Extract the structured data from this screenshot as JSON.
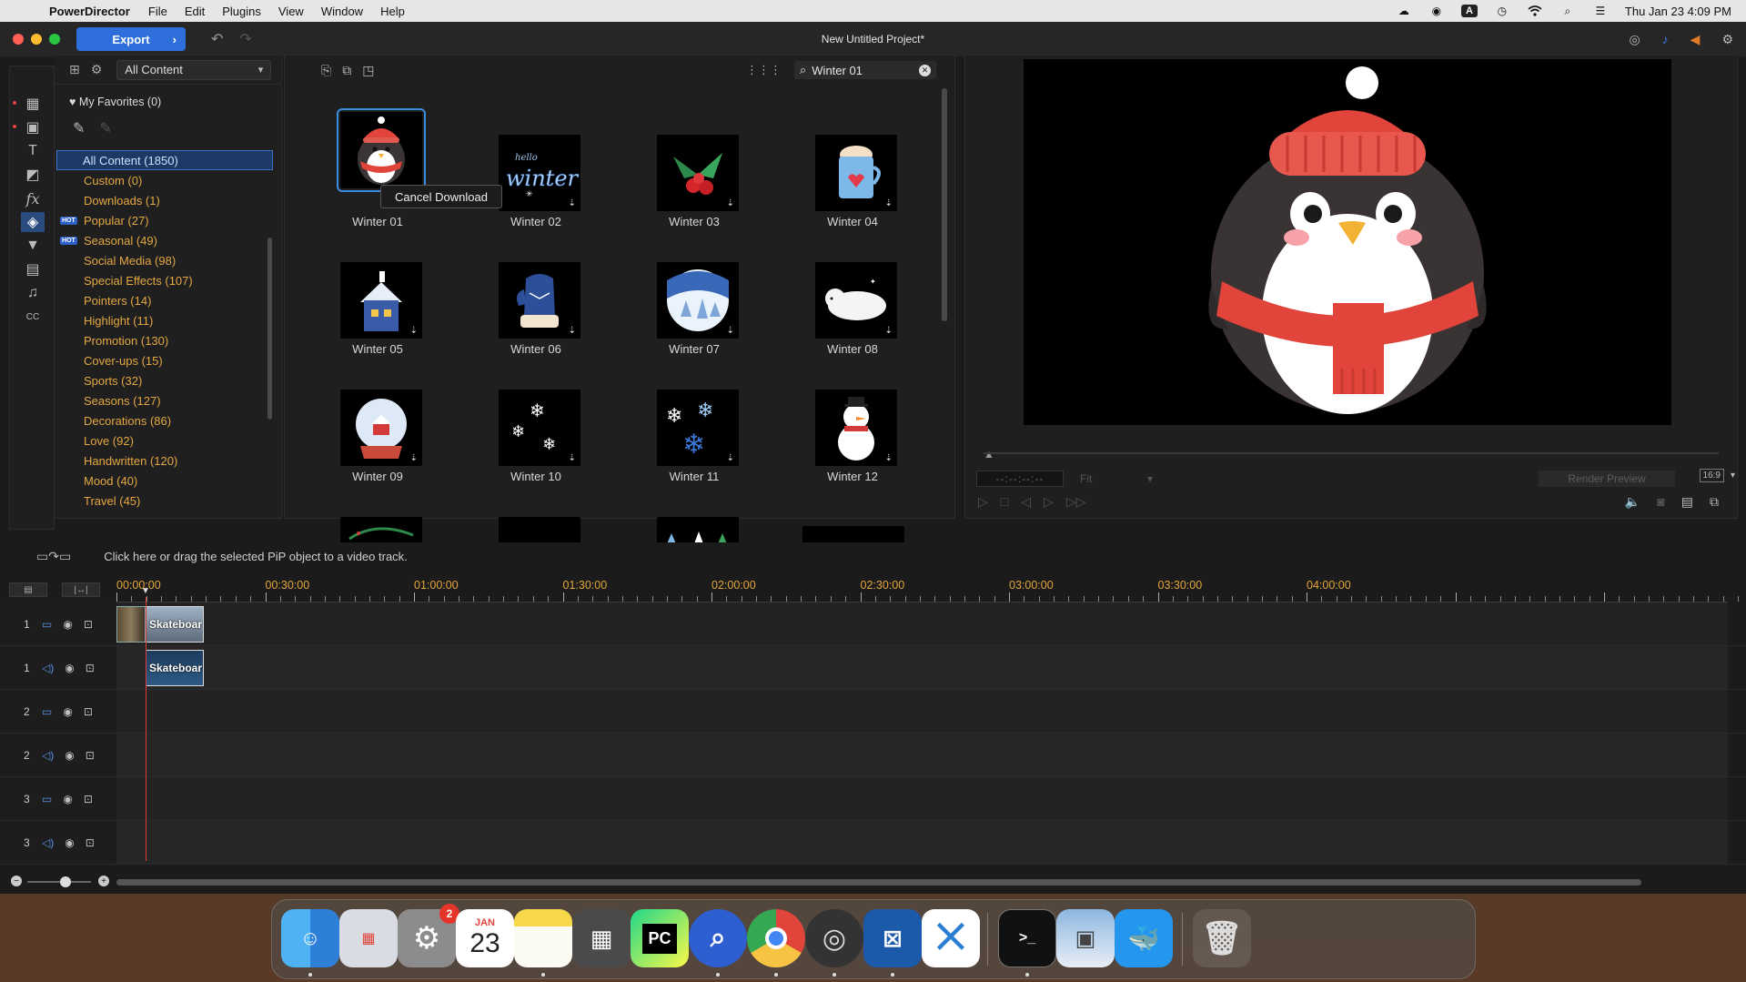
{
  "menubar": {
    "app_name": "PowerDirector",
    "menus": [
      "File",
      "Edit",
      "Plugins",
      "View",
      "Window",
      "Help"
    ],
    "clock": "Thu Jan 23  4:09 PM",
    "input_indicator": "A"
  },
  "window": {
    "title": "New Untitled Project*",
    "export_label": "Export"
  },
  "library": {
    "filter_value": "All Content",
    "search_value": "Winter 01",
    "favorites_label": "My Favorites (0)",
    "categories": [
      {
        "label": "All Content (1850)",
        "hot": false
      },
      {
        "label": "Custom (0)",
        "hot": false
      },
      {
        "label": "Downloads (1)",
        "hot": false
      },
      {
        "label": "Popular (27)",
        "hot": true
      },
      {
        "label": "Seasonal (49)",
        "hot": true
      },
      {
        "label": "Social Media (98)",
        "hot": false
      },
      {
        "label": "Special Effects (107)",
        "hot": false
      },
      {
        "label": "Pointers (14)",
        "hot": false
      },
      {
        "label": "Highlight (11)",
        "hot": false
      },
      {
        "label": "Promotion (130)",
        "hot": false
      },
      {
        "label": "Cover-ups (15)",
        "hot": false
      },
      {
        "label": "Sports (32)",
        "hot": false
      },
      {
        "label": "Seasons (127)",
        "hot": false
      },
      {
        "label": "Decorations (86)",
        "hot": false
      },
      {
        "label": "Love (92)",
        "hot": false
      },
      {
        "label": "Handwritten (120)",
        "hot": false
      },
      {
        "label": "Mood (40)",
        "hot": false
      },
      {
        "label": "Travel (45)",
        "hot": false
      }
    ],
    "hot_badge": "HOT",
    "tiles": [
      "Winter 01",
      "Winter 02",
      "Winter 03",
      "Winter 04",
      "Winter 05",
      "Winter 06",
      "Winter 07",
      "Winter 08",
      "Winter 09",
      "Winter 10",
      "Winter 11",
      "Winter 12"
    ],
    "tooltip": "Cancel Download",
    "tile_text_winter": "winter"
  },
  "preview": {
    "timecode": "--:--:--:--",
    "fit_label": "Fit",
    "render_label": "Render Preview",
    "ratio": "16:9"
  },
  "timeline": {
    "hint": "Click here or drag the selected PiP object to a video track.",
    "ruler_labels": [
      "00:00:00",
      "00:30:00",
      "01:00:00",
      "01:30:00",
      "02:00:00",
      "02:30:00",
      "03:00:00",
      "03:30:00",
      "04:00:00"
    ],
    "tracks": [
      {
        "num": "1",
        "kind": "video"
      },
      {
        "num": "1",
        "kind": "audio"
      },
      {
        "num": "2",
        "kind": "video"
      },
      {
        "num": "2",
        "kind": "audio"
      },
      {
        "num": "3",
        "kind": "video"
      },
      {
        "num": "3",
        "kind": "audio"
      }
    ],
    "clip_label": "Skateboar"
  },
  "dock": {
    "calendar_month": "JAN",
    "calendar_day": "23",
    "settings_badge": "2",
    "pycharm_label": "PC"
  },
  "colors": {
    "accent": "#2f6fdc",
    "category_text": "#e4a742",
    "ruler_text": "#e3a63a",
    "playhead": "#e03a3a"
  }
}
